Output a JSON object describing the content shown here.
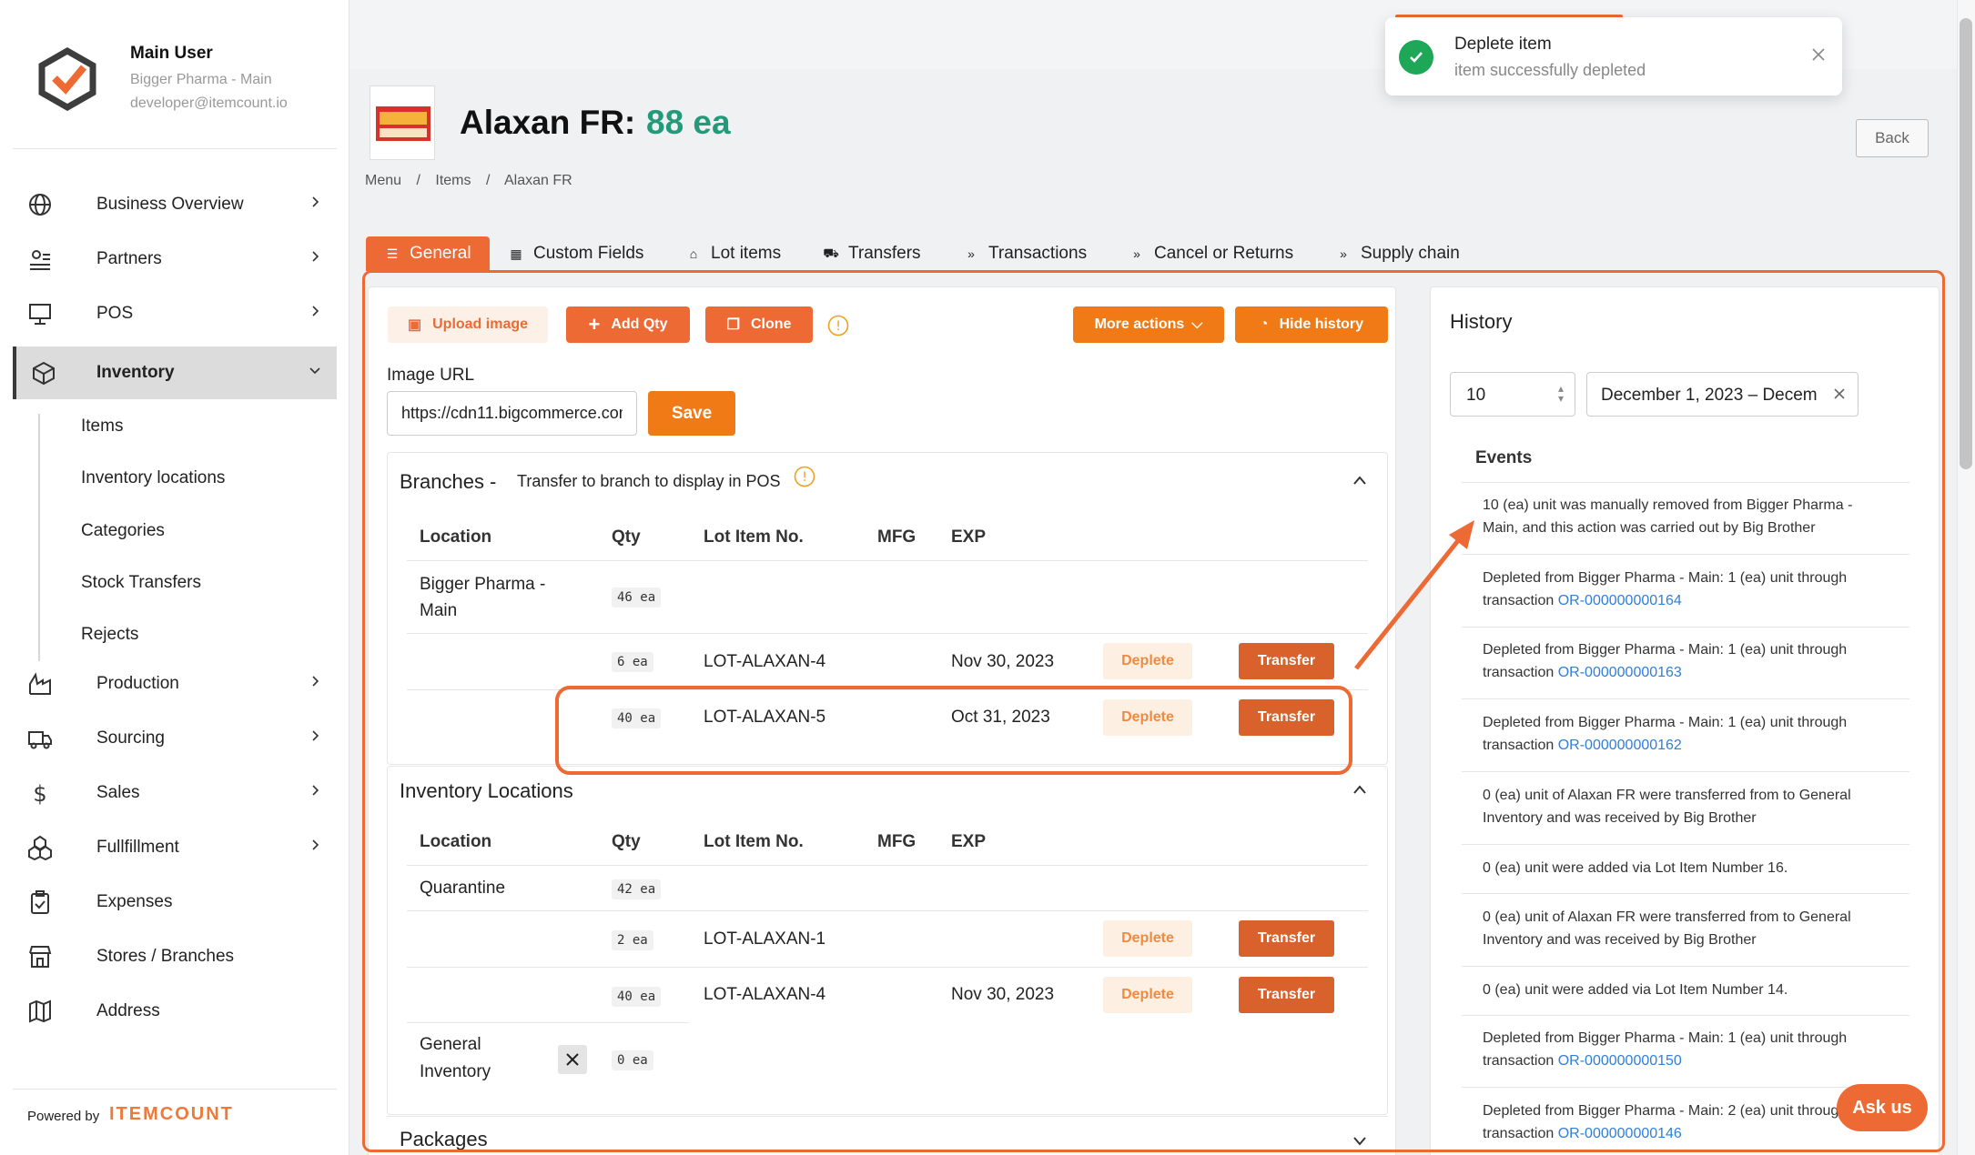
{
  "user": {
    "name": "Main User",
    "org": "Bigger Pharma - Main",
    "email": "developer@itemcount.io"
  },
  "sidebar": {
    "items": [
      {
        "label": "Business Overview"
      },
      {
        "label": "Partners"
      },
      {
        "label": "POS"
      },
      {
        "label": "Inventory"
      },
      {
        "label": "Production"
      },
      {
        "label": "Sourcing"
      },
      {
        "label": "Sales"
      },
      {
        "label": "Fullfillment"
      },
      {
        "label": "Expenses"
      },
      {
        "label": "Stores / Branches"
      },
      {
        "label": "Address"
      }
    ],
    "inventory_sub": [
      "Items",
      "Inventory locations",
      "Categories",
      "Stock Transfers",
      "Rejects"
    ],
    "powered_by": "Powered by",
    "brand": "ITEMCOUNT"
  },
  "toast": {
    "title": "Deplete item",
    "message": "item successfully depleted"
  },
  "item": {
    "name": "Alaxan FR:",
    "qty": "88 ea"
  },
  "breadcrumb": {
    "menu": "Menu",
    "items": "Items",
    "current": "Alaxan FR",
    "sep": "/"
  },
  "back_label": "Back",
  "tabs": [
    "General",
    "Custom Fields",
    "Lot items",
    "Transfers",
    "Transactions",
    "Cancel or Returns",
    "Supply chain"
  ],
  "actions": {
    "upload": "Upload image",
    "add_qty": "Add Qty",
    "clone": "Clone",
    "more": "More actions",
    "hide_history": "Hide history"
  },
  "image_url": {
    "label": "Image URL",
    "value": "https://cdn11.bigcommerce.com",
    "save": "Save"
  },
  "branches": {
    "title": "Branches -",
    "hint": "Transfer to branch to display in POS",
    "headers": [
      "Location",
      "Qty",
      "Lot Item No.",
      "MFG",
      "EXP"
    ],
    "location_line1": "Bigger Pharma -",
    "location_line2": "Main",
    "location_qty": "46 ea",
    "rows": [
      {
        "qty": "6 ea",
        "lot": "LOT-ALAXAN-4",
        "mfg": "",
        "exp": "Nov 30, 2023"
      },
      {
        "qty": "40 ea",
        "lot": "LOT-ALAXAN-5",
        "mfg": "",
        "exp": "Oct 31, 2023"
      }
    ],
    "deplete": "Deplete",
    "transfer": "Transfer"
  },
  "inv_locations": {
    "title": "Inventory Locations",
    "headers": [
      "Location",
      "Qty",
      "Lot Item No.",
      "MFG",
      "EXP"
    ],
    "quarantine": "Quarantine",
    "quarantine_qty": "42 ea",
    "rows": [
      {
        "qty": "2 ea",
        "lot": "LOT-ALAXAN-1",
        "exp": ""
      },
      {
        "qty": "40 ea",
        "lot": "LOT-ALAXAN-4",
        "exp": "Nov 30, 2023"
      }
    ],
    "general_line1": "General",
    "general_line2": "Inventory",
    "general_qty": "0 ea"
  },
  "packages": {
    "title": "Packages"
  },
  "history": {
    "title": "History",
    "limit": "10",
    "date_range": "December 1, 2023 – Decem",
    "events_label": "Events",
    "events": [
      {
        "text": "10 (ea) unit was manually removed from Bigger Pharma - Main, and this action was carried out by Big Brother",
        "link": ""
      },
      {
        "text": "Depleted from Bigger Pharma - Main: 1 (ea) unit through transaction ",
        "link": "OR-000000000164"
      },
      {
        "text": "Depleted from Bigger Pharma - Main: 1 (ea) unit through transaction ",
        "link": "OR-000000000163"
      },
      {
        "text": "Depleted from Bigger Pharma - Main: 1 (ea) unit through transaction ",
        "link": "OR-000000000162"
      },
      {
        "text": "0 (ea) unit of Alaxan FR were transferred from to General Inventory and was received by Big Brother",
        "link": ""
      },
      {
        "text": "0 (ea) unit were added via Lot Item Number 16.",
        "link": ""
      },
      {
        "text": "0 (ea) unit of Alaxan FR were transferred from to General Inventory and was received by Big Brother",
        "link": ""
      },
      {
        "text": "0 (ea) unit were added via Lot Item Number 14.",
        "link": ""
      },
      {
        "text": "Depleted from Bigger Pharma - Main: 1 (ea) unit through transaction ",
        "link": "OR-000000000150"
      },
      {
        "text": "Depleted from Bigger Pharma - Main: 2 (ea) unit through transaction ",
        "link": "OR-000000000146"
      }
    ]
  },
  "ask_us": "Ask us",
  "colors": {
    "accent": "#ee6a34",
    "qty_green": "#239a7a",
    "success": "#1fa758",
    "link": "#2f7fd8"
  }
}
